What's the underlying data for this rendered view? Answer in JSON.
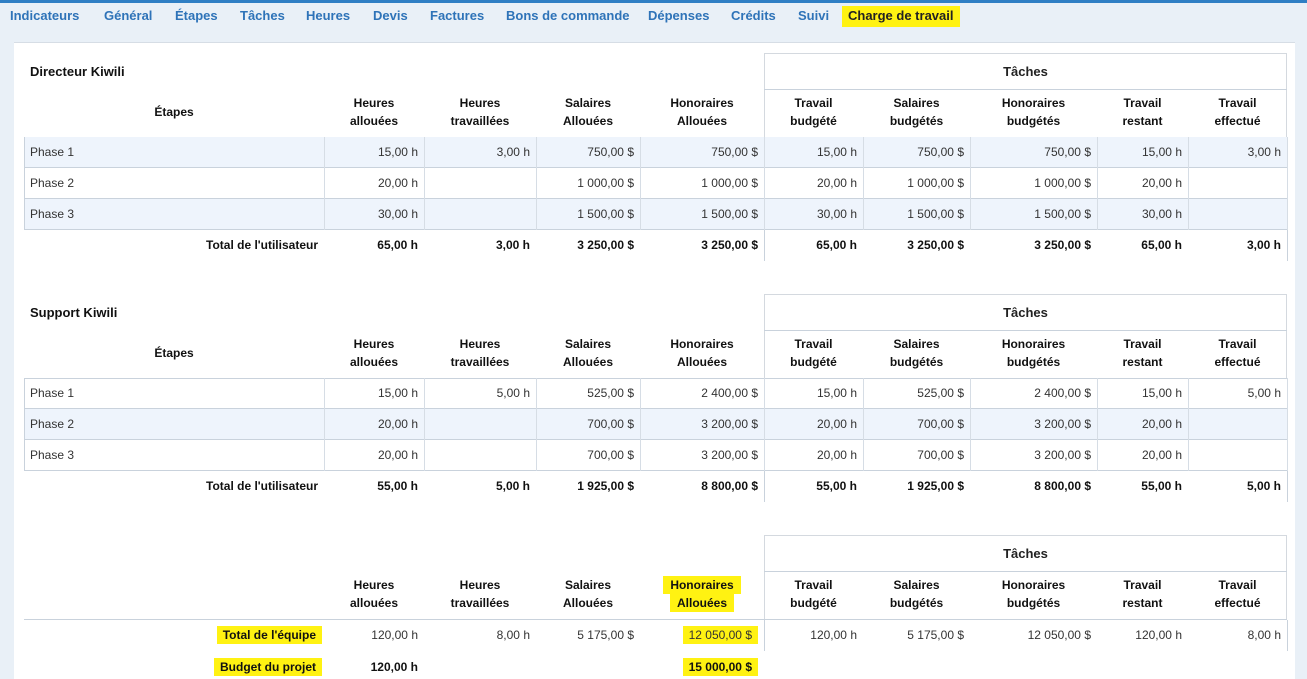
{
  "tabs": [
    "Indicateurs",
    "Général",
    "Étapes",
    "Tâches",
    "Heures",
    "Devis",
    "Factures",
    "Bons de commande",
    "Dépenses",
    "Crédits",
    "Suivi",
    "Charge de travail"
  ],
  "active_tab": "Charge de travail",
  "headers": {
    "etapes": "Étapes",
    "taches": "Tâches",
    "heures_allouees": [
      "Heures",
      "allouées"
    ],
    "heures_travaillees": [
      "Heures",
      "travaillées"
    ],
    "salaires_allouees": [
      "Salaires",
      "Allouées"
    ],
    "honoraires_allouees": [
      "Honoraires",
      "Allouées"
    ],
    "travail_budgete": [
      "Travail",
      "budgété"
    ],
    "salaires_budgetes": [
      "Salaires",
      "budgétés"
    ],
    "honoraires_budgetes": [
      "Honoraires",
      "budgétés"
    ],
    "travail_restant": [
      "Travail",
      "restant"
    ],
    "travail_effectue": [
      "Travail",
      "effectué"
    ]
  },
  "users": [
    {
      "name": "Directeur Kiwili",
      "rows": [
        {
          "phase": "Phase 1",
          "values": [
            "15,00 h",
            "3,00 h",
            "750,00 $",
            "750,00 $",
            "15,00 h",
            "750,00 $",
            "750,00 $",
            "15,00 h",
            "3,00 h"
          ]
        },
        {
          "phase": "Phase 2",
          "values": [
            "20,00 h",
            "",
            "1 000,00 $",
            "1 000,00 $",
            "20,00 h",
            "1 000,00 $",
            "1 000,00 $",
            "20,00 h",
            ""
          ]
        },
        {
          "phase": "Phase 3",
          "values": [
            "30,00 h",
            "",
            "1 500,00 $",
            "1 500,00 $",
            "30,00 h",
            "1 500,00 $",
            "1 500,00 $",
            "30,00 h",
            ""
          ]
        }
      ],
      "total_label": "Total de l'utilisateur",
      "total": [
        "65,00 h",
        "3,00 h",
        "3 250,00 $",
        "3 250,00 $",
        "65,00 h",
        "3 250,00 $",
        "3 250,00 $",
        "65,00 h",
        "3,00 h"
      ]
    },
    {
      "name": "Support Kiwili",
      "rows": [
        {
          "phase": "Phase 1",
          "values": [
            "15,00 h",
            "5,00 h",
            "525,00 $",
            "2 400,00 $",
            "15,00 h",
            "525,00 $",
            "2 400,00 $",
            "15,00 h",
            "5,00 h"
          ]
        },
        {
          "phase": "Phase 2",
          "values": [
            "20,00 h",
            "",
            "700,00 $",
            "3 200,00 $",
            "20,00 h",
            "700,00 $",
            "3 200,00 $",
            "20,00 h",
            ""
          ]
        },
        {
          "phase": "Phase 3",
          "values": [
            "20,00 h",
            "",
            "700,00 $",
            "3 200,00 $",
            "20,00 h",
            "700,00 $",
            "3 200,00 $",
            "20,00 h",
            ""
          ]
        }
      ],
      "total_label": "Total de l'utilisateur",
      "total": [
        "55,00 h",
        "5,00 h",
        "1 925,00 $",
        "8 800,00 $",
        "55,00 h",
        "1 925,00 $",
        "8 800,00 $",
        "55,00 h",
        "5,00 h"
      ]
    }
  ],
  "team": {
    "total_label": "Total de l'équipe",
    "total": [
      "120,00 h",
      "8,00 h",
      "5 175,00 $",
      "12 050,00 $",
      "120,00 h",
      "5 175,00 $",
      "12 050,00 $",
      "120,00 h",
      "8,00 h"
    ],
    "budget_label": "Budget du projet",
    "budget_heures": "120,00 h",
    "budget_honoraires": "15 000,00 $"
  },
  "colors": {
    "accent": "#2e73b8",
    "highlight": "#fff212",
    "row_shade": "#eef4fc"
  }
}
